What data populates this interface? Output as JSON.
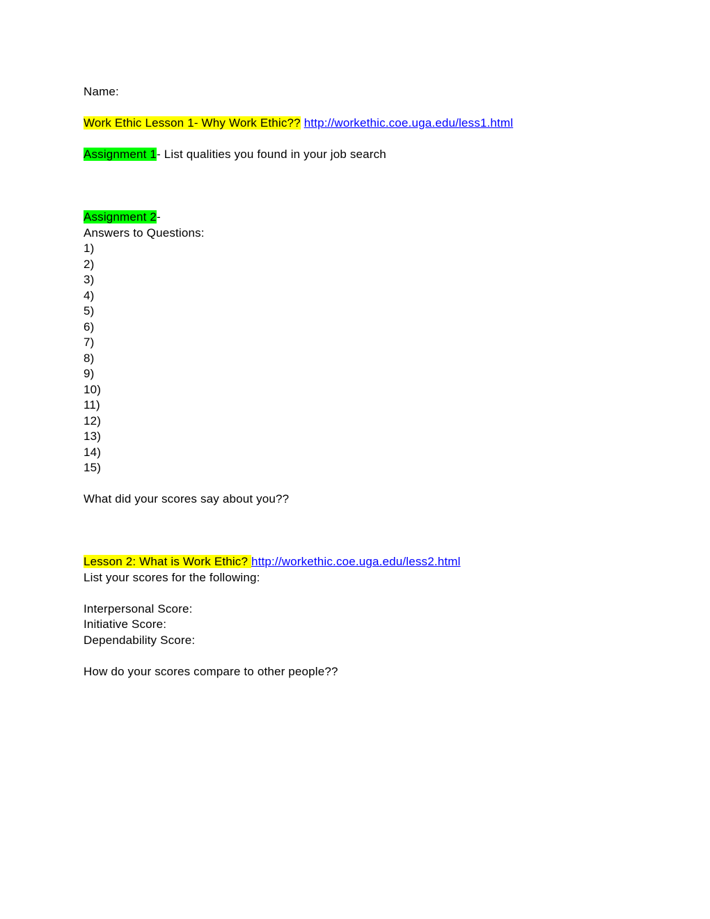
{
  "document": {
    "name_label": "Name:",
    "lesson1": {
      "heading_highlighted": "Work Ethic Lesson 1- Why Work Ethic??",
      "heading_highlight_color": "#FFFF00",
      "url": "http://workethic.coe.uga.edu/less1.html",
      "link_color": "#0000FF"
    },
    "assignment1": {
      "label_highlighted": "Assignment 1",
      "label_highlight_color": "#00FF00",
      "rest": "- List qualities you found in your job search"
    },
    "assignment2": {
      "label_highlighted": "Assignment 2",
      "label_highlight_color": "#00FF00",
      "rest": "-",
      "answers_label": "Answers to Questions:",
      "items": [
        "1)",
        "2)",
        "3)",
        "4)",
        "5)",
        "6)",
        "7)",
        "8)",
        "9)",
        "10)",
        "11)",
        "12)",
        "13)",
        "14)",
        "15)"
      ],
      "reflection_question": "What did your scores say about you??"
    },
    "lesson2": {
      "heading_highlighted": "Lesson 2: What is Work Ethic? ",
      "heading_highlight_color": "#FFFF00",
      "url": "http://workethic.coe.uga.edu/less2.html",
      "link_color": "#0000FF",
      "instruction": "List your scores for the following:",
      "scores": [
        "Interpersonal Score:",
        "Initiative Score:",
        "Dependability Score:"
      ],
      "comparison_question": "How do your scores compare to other people??"
    }
  }
}
